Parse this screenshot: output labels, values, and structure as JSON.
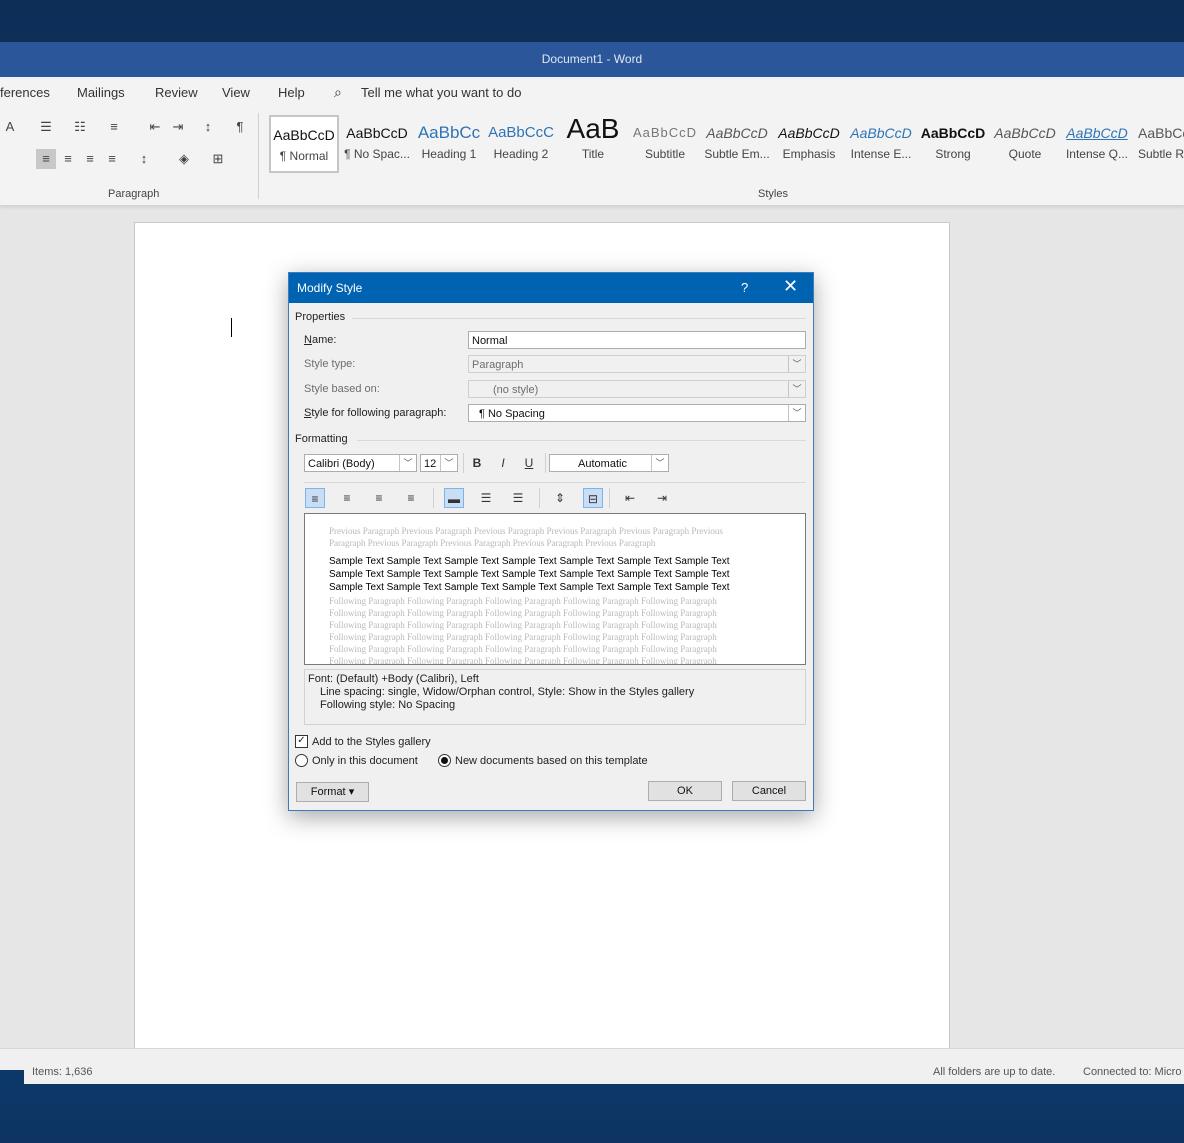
{
  "window": {
    "title": "Document1  -  Word"
  },
  "menu": [
    "ferences",
    "Mailings",
    "Review",
    "View",
    "Help"
  ],
  "tell_me": "Tell me what you want to do",
  "ribbon": {
    "paragraph_label": "Paragraph",
    "styles_label": "Styles",
    "styles": [
      {
        "preview": "AaBbCcD",
        "name": "¶ Normal"
      },
      {
        "preview": "AaBbCcD",
        "name": "¶ No Spac..."
      },
      {
        "preview": "AaBbCc",
        "name": "Heading 1"
      },
      {
        "preview": "AaBbCcC",
        "name": "Heading 2"
      },
      {
        "preview": "AaB",
        "name": "Title"
      },
      {
        "preview": "AaBbCcD",
        "name": "Subtitle"
      },
      {
        "preview": "AaBbCcD",
        "name": "Subtle Em..."
      },
      {
        "preview": "AaBbCcD",
        "name": "Emphasis"
      },
      {
        "preview": "AaBbCcD",
        "name": "Intense E..."
      },
      {
        "preview": "AaBbCcD",
        "name": "Strong"
      },
      {
        "preview": "AaBbCcD",
        "name": "Quote"
      },
      {
        "preview": "AaBbCcD",
        "name": "Intense Q..."
      },
      {
        "preview": "AaBbCcD",
        "name": "Subtle Re"
      }
    ]
  },
  "outlook_status": {
    "items": "Items: 1,636",
    "folders": "All folders are up to date.",
    "connected": "Connected to: Micro"
  },
  "dialog": {
    "title": "Modify Style",
    "help": "?",
    "properties_label": "Properties",
    "name_label": "Name:",
    "name_value": "Normal",
    "style_type_label": "Style type:",
    "style_type_value": "Paragraph",
    "based_on_label": "Style based on:",
    "based_on_value": "(no style)",
    "following_label": "Style for following paragraph:",
    "following_value": "¶  No Spacing",
    "formatting_label": "Formatting",
    "font": "Calibri (Body)",
    "size": "12",
    "bold": "B",
    "italic": "I",
    "underline": "U",
    "color": "Automatic",
    "preview_previous": "Previous Paragraph Previous Paragraph Previous Paragraph Previous Paragraph Previous Paragraph Previous Paragraph Previous Paragraph Previous Paragraph Previous Paragraph Previous Paragraph",
    "preview_sample": [
      "Sample Text Sample Text Sample Text Sample Text Sample Text Sample Text Sample Text",
      "Sample Text Sample Text Sample Text Sample Text Sample Text Sample Text Sample Text",
      "Sample Text Sample Text Sample Text Sample Text Sample Text Sample Text Sample Text"
    ],
    "preview_following": [
      "Following Paragraph Following Paragraph Following Paragraph Following Paragraph Following Paragraph",
      "Following Paragraph Following Paragraph Following Paragraph Following Paragraph Following Paragraph",
      "Following Paragraph Following Paragraph Following Paragraph Following Paragraph Following Paragraph",
      "Following Paragraph Following Paragraph Following Paragraph Following Paragraph Following Paragraph",
      "Following Paragraph Following Paragraph Following Paragraph Following Paragraph Following Paragraph",
      "Following Paragraph Following Paragraph Following Paragraph Following Paragraph Following Paragraph"
    ],
    "desc_line1": "Font: (Default) +Body (Calibri), Left",
    "desc_line2": "Line spacing:  single, Widow/Orphan control, Style: Show in the Styles gallery",
    "desc_line3": "Following style: No Spacing",
    "add_gallery": "Add to the Styles gallery",
    "only_this_doc": "Only in this document",
    "new_docs": "New documents based on this template",
    "format_btn": "Format",
    "ok_btn": "OK",
    "cancel_btn": "Cancel"
  },
  "colors": {
    "title_blue": "#2b579a",
    "dialog_title": "#0063b1"
  }
}
